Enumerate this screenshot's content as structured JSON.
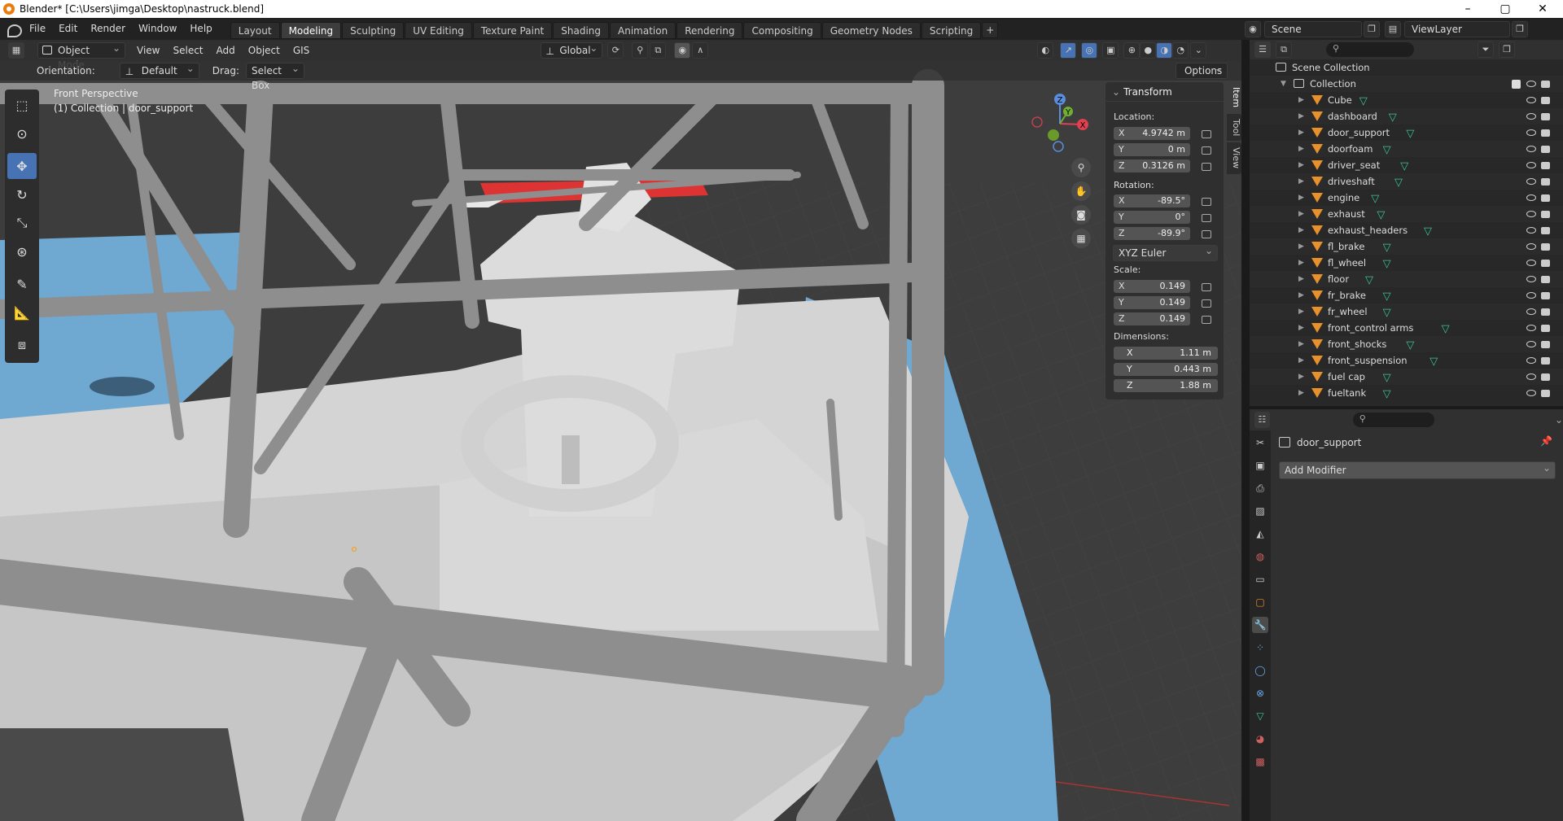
{
  "window": {
    "title": "Blender* [C:\\Users\\jimga\\Desktop\\nastruck.blend]",
    "controls": [
      "–",
      "▢",
      "✕"
    ]
  },
  "menu": [
    "File",
    "Edit",
    "Render",
    "Window",
    "Help"
  ],
  "workspaces": [
    "Layout",
    "Modeling",
    "Sculpting",
    "UV Editing",
    "Texture Paint",
    "Shading",
    "Animation",
    "Rendering",
    "Compositing",
    "Geometry Nodes",
    "Scripting"
  ],
  "active_workspace": "Modeling",
  "scene": {
    "scene_name": "Scene",
    "view_layer": "ViewLayer"
  },
  "viewport_header": {
    "mode": "Object Mode",
    "menus": [
      "View",
      "Select",
      "Add",
      "Object",
      "GIS"
    ],
    "transform_orientation": "Global"
  },
  "tool_settings": {
    "orientation_label": "Orientation:",
    "orientation_value": "Default",
    "drag_label": "Drag:",
    "drag_value": "Select Box",
    "options": "Options"
  },
  "viewport": {
    "view_name": "Front Perspective",
    "object_info": "(1) Collection | door_support"
  },
  "gizmo": {
    "x": "X",
    "y": "Y",
    "z": "Z"
  },
  "npanel": {
    "title": "Transform",
    "location_label": "Location:",
    "location": [
      {
        "axis": "X",
        "value": "4.9742 m"
      },
      {
        "axis": "Y",
        "value": "0 m"
      },
      {
        "axis": "Z",
        "value": "0.3126 m"
      }
    ],
    "rotation_label": "Rotation:",
    "rotation": [
      {
        "axis": "X",
        "value": "-89.5°"
      },
      {
        "axis": "Y",
        "value": "0°"
      },
      {
        "axis": "Z",
        "value": "-89.9°"
      }
    ],
    "rotation_mode": "XYZ Euler",
    "scale_label": "Scale:",
    "scale": [
      {
        "axis": "X",
        "value": "0.149"
      },
      {
        "axis": "Y",
        "value": "0.149"
      },
      {
        "axis": "Z",
        "value": "0.149"
      }
    ],
    "dimensions_label": "Dimensions:",
    "dimensions": [
      {
        "axis": "X",
        "value": "1.11 m"
      },
      {
        "axis": "Y",
        "value": "0.443 m"
      },
      {
        "axis": "Z",
        "value": "1.88 m"
      }
    ],
    "tabs": [
      "Item",
      "Tool",
      "View"
    ]
  },
  "outliner": {
    "root": "Scene Collection",
    "collection": "Collection",
    "objects": [
      "Cube",
      "dashboard",
      "door_support",
      "doorfoam",
      "driver_seat",
      "driveshaft",
      "engine",
      "exhaust",
      "exhaust_headers",
      "fl_brake",
      "fl_wheel",
      "floor",
      "fr_brake",
      "fr_wheel",
      "front_control arms",
      "front_shocks",
      "front_suspension",
      "fuel cap",
      "fueltank"
    ]
  },
  "properties": {
    "object_name": "door_support",
    "add_modifier": "Add Modifier"
  }
}
